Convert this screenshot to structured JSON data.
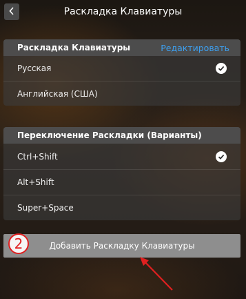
{
  "header": {
    "title": "Раскладка Клавиатуры",
    "back_icon": "chevron-left-icon"
  },
  "layouts_panel": {
    "heading": "Раскладка Клавиатуры",
    "edit_label": "Редактировать",
    "items": [
      {
        "label": "Русская",
        "checked": true
      },
      {
        "label": "Английская (США)",
        "checked": false
      }
    ]
  },
  "switch_panel": {
    "heading": "Переключение Раскладки (Варианты)",
    "items": [
      {
        "label": "Ctrl+Shift",
        "checked": true
      },
      {
        "label": "Alt+Shift",
        "checked": false
      },
      {
        "label": "Super+Space",
        "checked": false
      }
    ]
  },
  "add_button": {
    "label": "Добавить Раскладку Клавиатуры"
  },
  "annotation": {
    "step_number": "2",
    "color": "#e02020"
  }
}
